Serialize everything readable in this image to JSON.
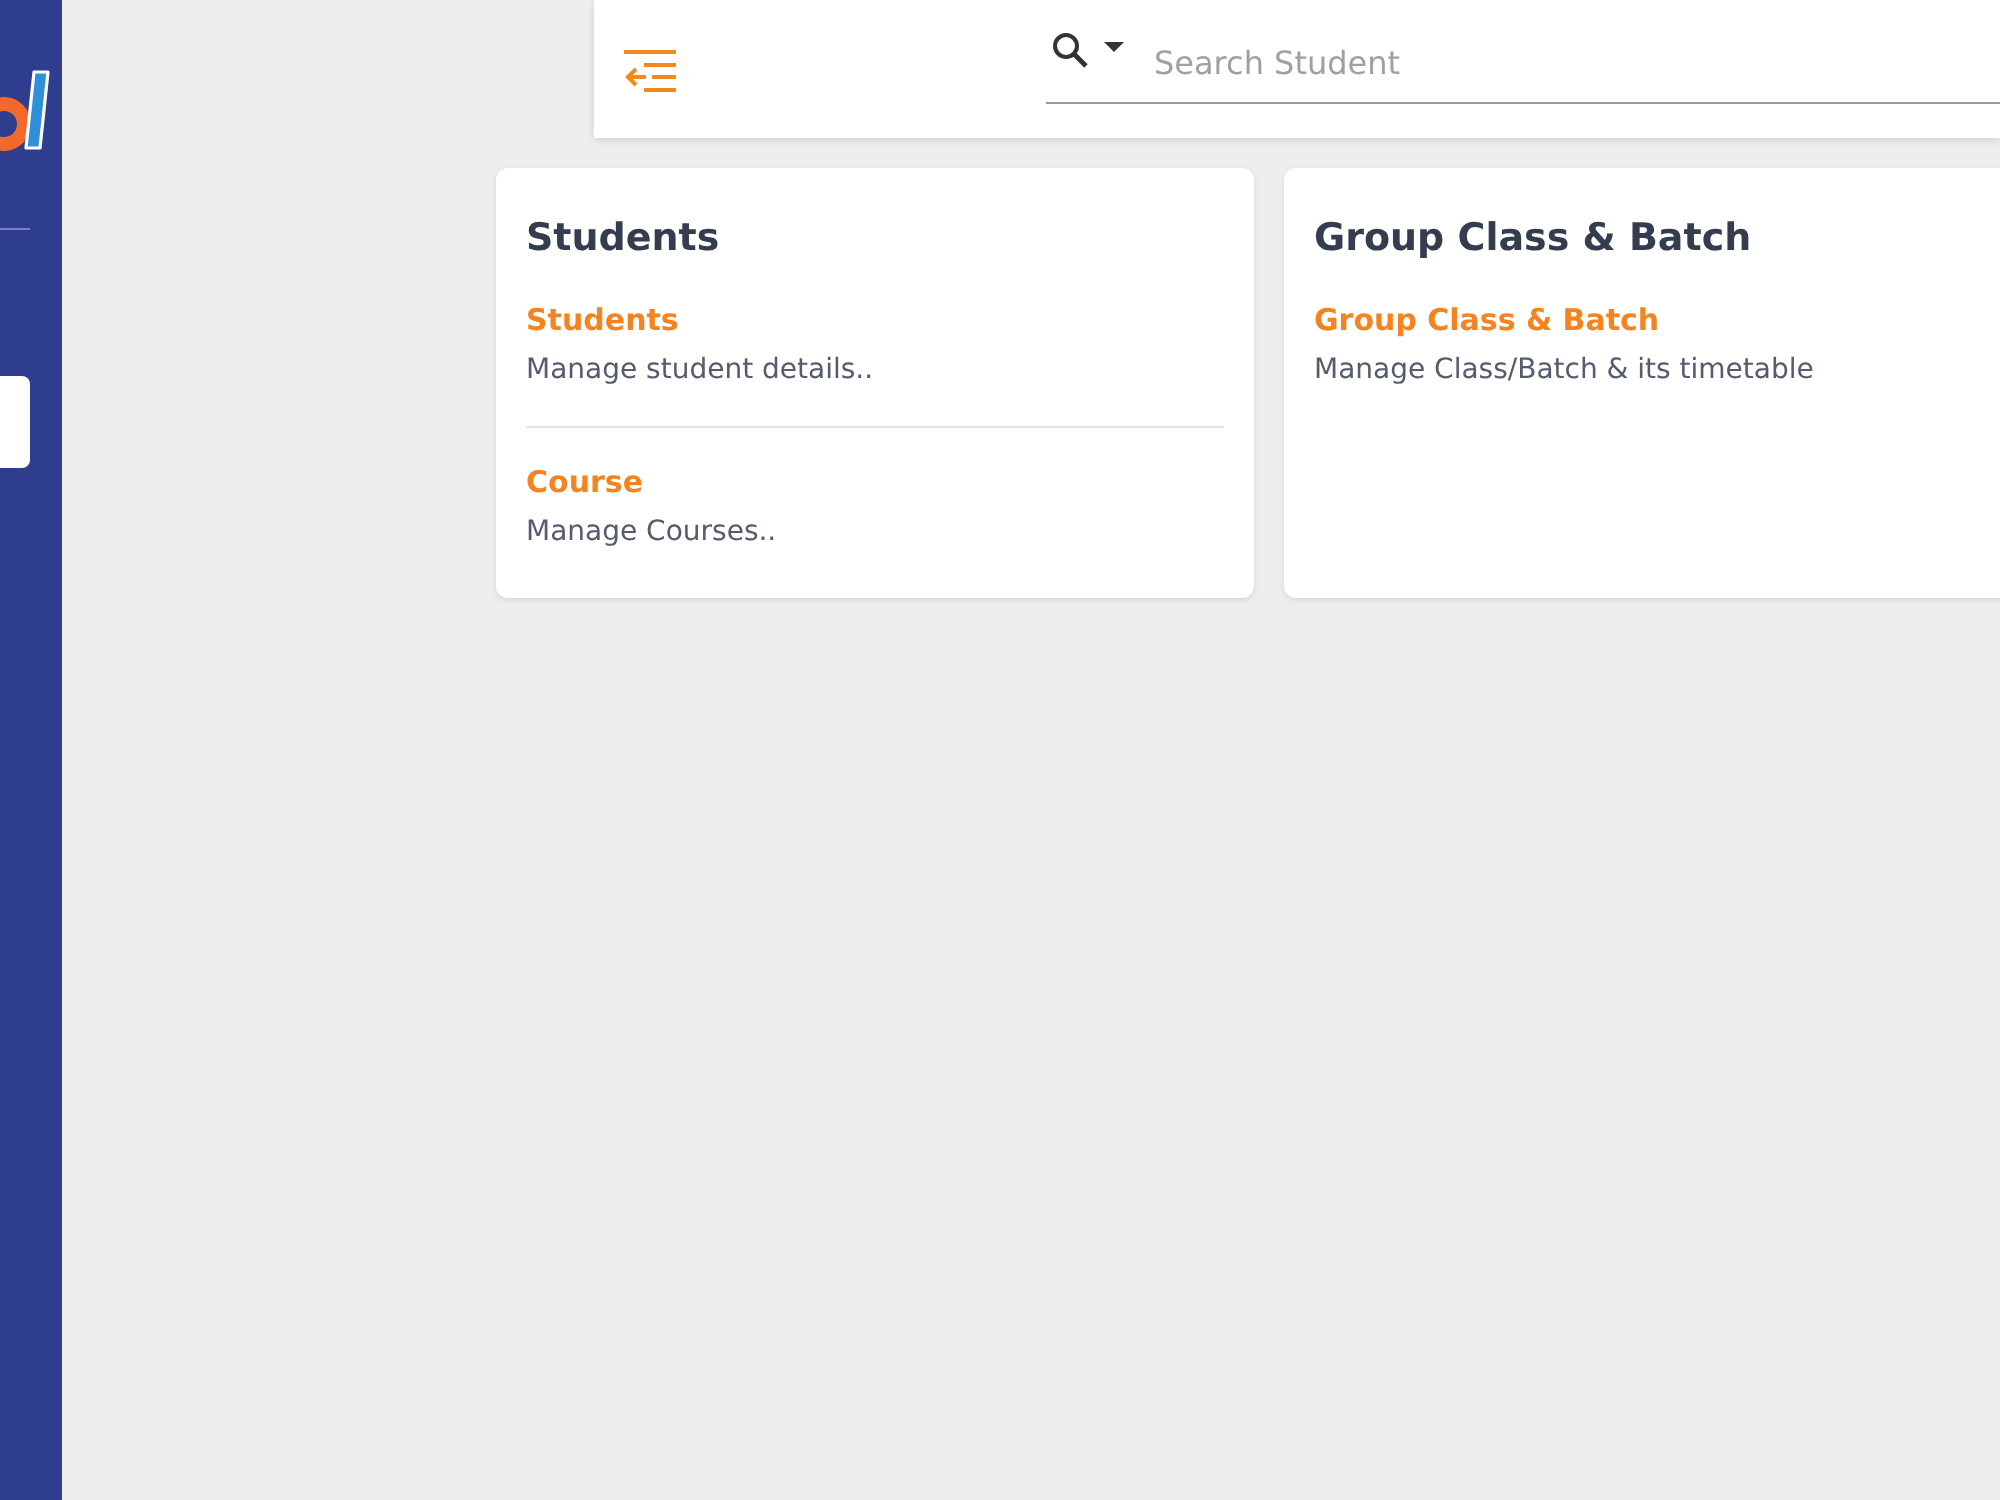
{
  "sidebar": {
    "items": [
      {
        "selected": true
      }
    ]
  },
  "header": {
    "search": {
      "placeholder": "Search Student"
    }
  },
  "cards": [
    {
      "title": "Students",
      "entries": [
        {
          "title": "Students",
          "description": "Manage student details.."
        },
        {
          "title": "Course",
          "description": "Manage Courses.."
        }
      ]
    },
    {
      "title": "Group Class & Batch",
      "entries": [
        {
          "title": "Group Class & Batch",
          "description": "Manage Class/Batch & its timetable"
        }
      ]
    }
  ]
}
